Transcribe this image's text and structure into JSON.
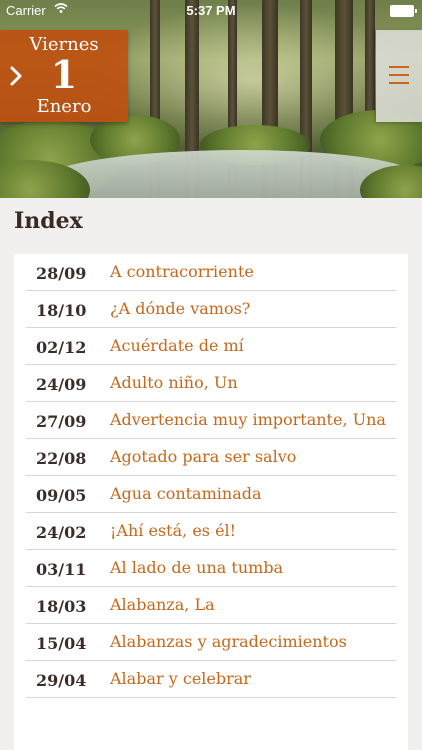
{
  "status_bar": {
    "carrier": "Carrier",
    "time": "5:37 PM"
  },
  "header": {
    "day_name": "Viernes",
    "day_number": "1",
    "month": "Enero"
  },
  "index": {
    "title": "Index",
    "items": [
      {
        "date": "28/09",
        "title": "A contracorriente"
      },
      {
        "date": "18/10",
        "title": "¿A dónde vamos?"
      },
      {
        "date": "02/12",
        "title": "Acuérdate de mí"
      },
      {
        "date": "24/09",
        "title": "Adulto niño, Un"
      },
      {
        "date": "27/09",
        "title": "Advertencia muy importante, Una"
      },
      {
        "date": "22/08",
        "title": "Agotado para ser salvo"
      },
      {
        "date": "09/05",
        "title": "Agua contaminada"
      },
      {
        "date": "24/02",
        "title": "¡Ahí está, es él!"
      },
      {
        "date": "03/11",
        "title": "Al lado de una tumba"
      },
      {
        "date": "18/03",
        "title": "Alabanza, La"
      },
      {
        "date": "15/04",
        "title": "Alabanzas y agradecimientos"
      },
      {
        "date": "29/04",
        "title": "Alabar y celebrar"
      }
    ]
  },
  "colors": {
    "accent": "#c5681b",
    "date_box": "#be5010",
    "background": "#f2f0ef"
  },
  "icons": [
    "chevron-right-icon",
    "hamburger-menu-icon",
    "wifi-icon",
    "battery-icon"
  ]
}
